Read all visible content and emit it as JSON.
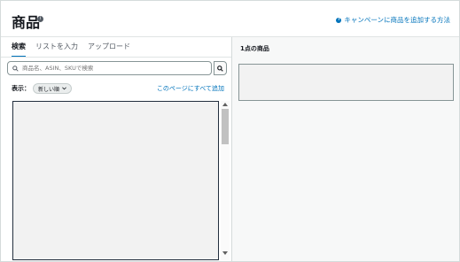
{
  "header": {
    "title": "商品",
    "help_link": "キャンペーンに商品を追加する方法"
  },
  "tabs": [
    {
      "label": "検索",
      "active": true
    },
    {
      "label": "リストを入力",
      "active": false
    },
    {
      "label": "アップロード",
      "active": false
    }
  ],
  "search": {
    "placeholder": "商品名、ASIN、SKUで検索",
    "value": ""
  },
  "display": {
    "label": "表示：",
    "sort_value": "新しい順",
    "add_all_link": "このページにすべて追加"
  },
  "selected": {
    "title": "1点の商品"
  },
  "colors": {
    "accent": "#0073bb",
    "text": "#16191f",
    "border": "#d5dbdb"
  }
}
